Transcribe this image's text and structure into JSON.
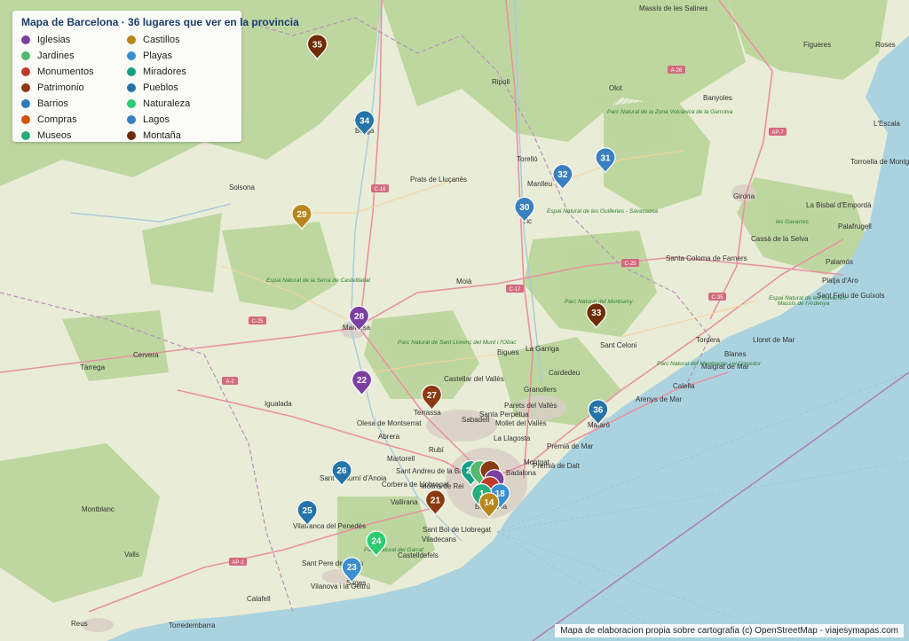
{
  "legend": {
    "title": "Mapa de Barcelona · 36 lugares que ver en la provincia",
    "categories": [
      {
        "label": "Iglesias",
        "color": "#7b3fa0"
      },
      {
        "label": "Jardines",
        "color": "#52b96e"
      },
      {
        "label": "Monumentos",
        "color": "#c0392b"
      },
      {
        "label": "Patrimonio",
        "color": "#8b3a12"
      },
      {
        "label": "Barrios",
        "color": "#2e7bb5"
      },
      {
        "label": "Compras",
        "color": "#d35400"
      },
      {
        "label": "Museos",
        "color": "#27ae7a"
      },
      {
        "label": "Castillos",
        "color": "#b8861b"
      },
      {
        "label": "Playas",
        "color": "#3b8ed0"
      },
      {
        "label": "Miradores",
        "color": "#16a085"
      },
      {
        "label": "Pueblos",
        "color": "#2574a9"
      },
      {
        "label": "Naturaleza",
        "color": "#2ecc71"
      },
      {
        "label": "Lagos",
        "color": "#3a7fbf"
      },
      {
        "label": "Montaña",
        "color": "#6e2c00"
      }
    ]
  },
  "attribution": "Mapa de elaboracion propia sobre cartografia (c) OpenStreetMap - viajesymapas.com",
  "places": [
    {
      "name": "Figueres"
    },
    {
      "name": "Girona"
    },
    {
      "name": "Banyoles"
    },
    {
      "name": "Olot"
    },
    {
      "name": "Ripoll"
    },
    {
      "name": "Berga"
    },
    {
      "name": "Solsona"
    },
    {
      "name": "Manresa"
    },
    {
      "name": "Vic"
    },
    {
      "name": "Moià"
    },
    {
      "name": "Tàrrega"
    },
    {
      "name": "Cervera"
    },
    {
      "name": "Igualada"
    },
    {
      "name": "Terrassa"
    },
    {
      "name": "Sabadell"
    },
    {
      "name": "Granollers"
    },
    {
      "name": "Mataró"
    },
    {
      "name": "Badalona"
    },
    {
      "name": "Barcelona"
    },
    {
      "name": "Rubí"
    },
    {
      "name": "Sitges"
    },
    {
      "name": "Vilanova i la Geltrú"
    },
    {
      "name": "Castelldefels"
    },
    {
      "name": "Viladecans"
    },
    {
      "name": "Sant Boi de Llobregat"
    },
    {
      "name": "Reus"
    },
    {
      "name": "Calafell"
    },
    {
      "name": "Palafrugell"
    },
    {
      "name": "Palamós"
    },
    {
      "name": "Blanes"
    },
    {
      "name": "Lloret de Mar"
    },
    {
      "name": "Tordera"
    },
    {
      "name": "Santa Coloma de Farners"
    },
    {
      "name": "Cassà de la Selva"
    },
    {
      "name": "Torroella de Montgrí"
    },
    {
      "name": "Montblanc"
    },
    {
      "name": "Valls"
    },
    {
      "name": "Torredembarra"
    },
    {
      "name": "Cardedeu"
    },
    {
      "name": "La Garriga"
    },
    {
      "name": "Prats de Lluçanès"
    },
    {
      "name": "Manlleu"
    },
    {
      "name": "Torelló"
    },
    {
      "name": "Sant Celoni"
    },
    {
      "name": "Calella"
    },
    {
      "name": "Malgrat de Mar"
    },
    {
      "name": "Premià de Mar"
    },
    {
      "name": "Montgat"
    },
    {
      "name": "Mollet del Vallès"
    },
    {
      "name": "Parets del Vallès"
    },
    {
      "name": "Bigues"
    },
    {
      "name": "Castellar del Vallès"
    },
    {
      "name": "Olesa de Montserrat"
    },
    {
      "name": "Abrera"
    },
    {
      "name": "Martorell"
    },
    {
      "name": "Sant Andreu de la Barca"
    },
    {
      "name": "Corbera de Llobregat"
    },
    {
      "name": "Molins de Rei"
    },
    {
      "name": "Vallirana"
    },
    {
      "name": "Sant Sadurní d'Anoia"
    },
    {
      "name": "Vilafranca del Penedès"
    },
    {
      "name": "La Bisbal d'Empordà"
    },
    {
      "name": "Sant Feliu de Guíxols"
    },
    {
      "name": "Platja d'Aro"
    },
    {
      "name": "Arenys de Mar"
    },
    {
      "name": "Roses"
    },
    {
      "name": "L'Escala"
    },
    {
      "name": "Santa Perpètua"
    },
    {
      "name": "La Llagosta"
    },
    {
      "name": "Sant Pere de Ribes"
    },
    {
      "name": "Premià de Dalt"
    },
    {
      "name": "Massís de les Salines"
    }
  ],
  "parks": [
    {
      "name": "Parc Natural de la Zona Volcànica de la Garrotxa"
    },
    {
      "name": "Parc Natural del Montseny"
    },
    {
      "name": "Parc Natural de Sant Llorenç del Munt i l'Obac"
    },
    {
      "name": "Espai Natural de les Guilleries - Savassona"
    },
    {
      "name": "Espai Natural de la Serra de Castelltallat"
    },
    {
      "name": "Parc Natural del Garraf"
    },
    {
      "name": "Espai Natural de les Gavarres"
    },
    {
      "name": "Parc Natural del Montnegre i el Corredor"
    },
    {
      "name": "les Gavarres"
    },
    {
      "name": "Massís de l'Ardenya"
    }
  ],
  "roads": [
    {
      "name": "A-26"
    },
    {
      "name": "AP-7"
    },
    {
      "name": "C-16"
    },
    {
      "name": "C-17"
    },
    {
      "name": "C-25"
    },
    {
      "name": "C-35"
    },
    {
      "name": "A-2"
    },
    {
      "name": "AP-2"
    },
    {
      "name": "C-25"
    }
  ],
  "markers": [
    {
      "num": "35",
      "cat": 13,
      "lon": 0.349,
      "lat": 0.073
    },
    {
      "num": "34",
      "cat": 10,
      "lon": 0.401,
      "lat": 0.192
    },
    {
      "num": "31",
      "cat": 12,
      "lon": 0.666,
      "lat": 0.25
    },
    {
      "num": "32",
      "cat": 12,
      "lon": 0.619,
      "lat": 0.276
    },
    {
      "num": "30",
      "cat": 12,
      "lon": 0.577,
      "lat": 0.327
    },
    {
      "num": "29",
      "cat": 7,
      "lon": 0.332,
      "lat": 0.338
    },
    {
      "num": "33",
      "cat": 13,
      "lon": 0.656,
      "lat": 0.492
    },
    {
      "num": "28",
      "cat": 0,
      "lon": 0.395,
      "lat": 0.497
    },
    {
      "num": "22",
      "cat": 0,
      "lon": 0.398,
      "lat": 0.597
    },
    {
      "num": "27",
      "cat": 3,
      "lon": 0.475,
      "lat": 0.62
    },
    {
      "num": "36",
      "cat": 10,
      "lon": 0.658,
      "lat": 0.643
    },
    {
      "num": "26",
      "cat": 10,
      "lon": 0.376,
      "lat": 0.738
    },
    {
      "num": "20",
      "cat": 9,
      "lon": 0.518,
      "lat": 0.738
    },
    {
      "num": "",
      "cat": 1,
      "lon": 0.528,
      "lat": 0.738
    },
    {
      "num": "",
      "cat": 3,
      "lon": 0.539,
      "lat": 0.738
    },
    {
      "num": "",
      "cat": 0,
      "lon": 0.544,
      "lat": 0.752
    },
    {
      "num": "",
      "cat": 2,
      "lon": 0.539,
      "lat": 0.763
    },
    {
      "num": "18",
      "cat": 8,
      "lon": 0.55,
      "lat": 0.774
    },
    {
      "num": "1",
      "cat": 6,
      "lon": 0.53,
      "lat": 0.774
    },
    {
      "num": "14",
      "cat": 7,
      "lon": 0.538,
      "lat": 0.788
    },
    {
      "num": "21",
      "cat": 3,
      "lon": 0.479,
      "lat": 0.784
    },
    {
      "num": "25",
      "cat": 10,
      "lon": 0.338,
      "lat": 0.8
    },
    {
      "num": "24",
      "cat": 11,
      "lon": 0.414,
      "lat": 0.848
    },
    {
      "num": "23",
      "cat": 8,
      "lon": 0.387,
      "lat": 0.889
    }
  ]
}
